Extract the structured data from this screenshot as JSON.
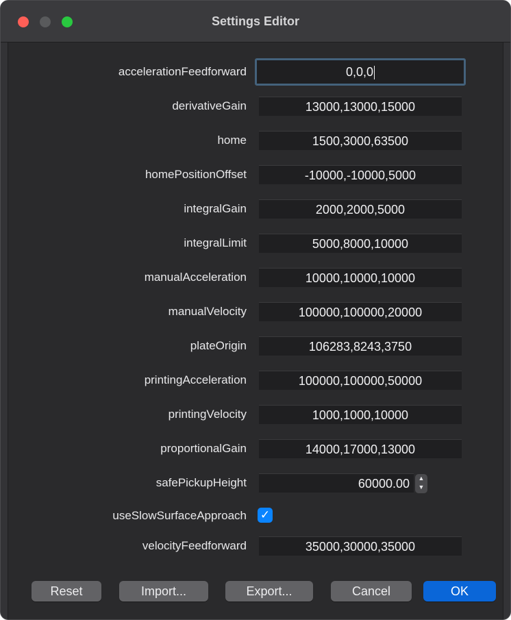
{
  "window": {
    "title": "Settings Editor"
  },
  "settings": [
    {
      "label": "accelerationFeedforward",
      "value": "0,0,0",
      "type": "text",
      "focused": true
    },
    {
      "label": "derivativeGain",
      "value": "13000,13000,15000",
      "type": "text"
    },
    {
      "label": "home",
      "value": "1500,3000,63500",
      "type": "text"
    },
    {
      "label": "homePositionOffset",
      "value": "-10000,-10000,5000",
      "type": "text"
    },
    {
      "label": "integralGain",
      "value": "2000,2000,5000",
      "type": "text"
    },
    {
      "label": "integralLimit",
      "value": "5000,8000,10000",
      "type": "text"
    },
    {
      "label": "manualAcceleration",
      "value": "10000,10000,10000",
      "type": "text"
    },
    {
      "label": "manualVelocity",
      "value": "100000,100000,20000",
      "type": "text"
    },
    {
      "label": "plateOrigin",
      "value": "106283,8243,3750",
      "type": "text"
    },
    {
      "label": "printingAcceleration",
      "value": "100000,100000,50000",
      "type": "text"
    },
    {
      "label": "printingVelocity",
      "value": "1000,1000,10000",
      "type": "text"
    },
    {
      "label": "proportionalGain",
      "value": "14000,17000,13000",
      "type": "text"
    },
    {
      "label": "safePickupHeight",
      "value": "60000.00",
      "type": "spin"
    },
    {
      "label": "useSlowSurfaceApproach",
      "value": "✓",
      "checked": true,
      "type": "checkbox"
    },
    {
      "label": "velocityFeedforward",
      "value": "35000,30000,35000",
      "type": "text"
    }
  ],
  "buttons": {
    "reset": "Reset",
    "import": "Import...",
    "export": "Export...",
    "cancel": "Cancel",
    "ok": "OK"
  },
  "colors": {
    "accent": "#0a66d8",
    "checkbox": "#0a84ff",
    "close": "#fe5f57",
    "minimize_inactive": "#595a5c",
    "maximize": "#29c840"
  }
}
